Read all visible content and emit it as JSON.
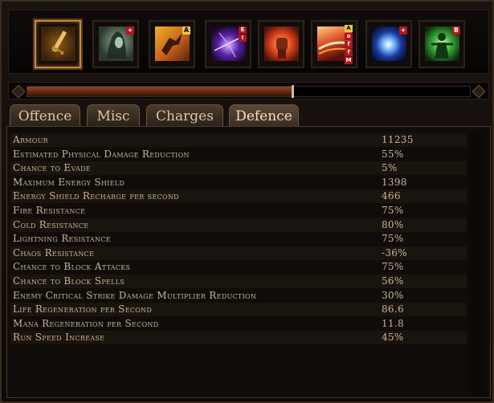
{
  "skills": [
    {
      "name": "sword-skill-icon",
      "active": true,
      "tags": []
    },
    {
      "name": "hooded-figure-skill-icon",
      "tags": [
        {
          "text": "+",
          "color": "red"
        }
      ]
    },
    {
      "name": "leaping-warrior-skill-icon",
      "tags": [
        {
          "text": "A",
          "color": "green"
        }
      ]
    },
    {
      "name": "purple-energy-skill-icon",
      "tags": [
        {
          "text": "E",
          "color": "red"
        },
        {
          "text": "!",
          "color": "red"
        }
      ]
    },
    {
      "name": "fire-fist-skill-icon",
      "tags": []
    },
    {
      "name": "flame-slash-skill-icon",
      "tags": [
        {
          "text": "A",
          "color": "green"
        },
        {
          "text": "o",
          "color": "red"
        },
        {
          "text": "f",
          "color": "red"
        },
        {
          "text": "f",
          "color": "red"
        },
        {
          "text": "M",
          "color": "red"
        }
      ]
    },
    {
      "name": "blue-orb-skill-icon",
      "tags": [
        {
          "text": "+",
          "color": "red"
        }
      ]
    },
    {
      "name": "green-aura-skill-icon",
      "tags": [
        {
          "text": "B",
          "color": "red"
        }
      ]
    }
  ],
  "experience": {
    "progress": 0.6
  },
  "tabs": {
    "offence": "Offence",
    "misc": "Misc",
    "charges": "Charges",
    "defence": "Defence",
    "active": "defence"
  },
  "stats": [
    {
      "label": "Armour",
      "value": "11235"
    },
    {
      "label": "Estimated Physical Damage Reduction",
      "value": "55%"
    },
    {
      "label": "Chance to Evade",
      "value": "5%"
    },
    {
      "label": "Maximum Energy Shield",
      "value": "1398"
    },
    {
      "label": "Energy Shield Recharge per second",
      "value": "466"
    },
    {
      "label": "Fire Resistance",
      "value": "75%"
    },
    {
      "label": "Cold Resistance",
      "value": "80%"
    },
    {
      "label": "Lightning Resistance",
      "value": "75%"
    },
    {
      "label": "Chaos Resistance",
      "value": "-36%"
    },
    {
      "label": "Chance to Block Attacks",
      "value": "75%"
    },
    {
      "label": "Chance to Block Spells",
      "value": "56%"
    },
    {
      "label": "Enemy Critical Strike Damage Multiplier Reduction",
      "value": "30%"
    },
    {
      "label": "Life Regeneration per Second",
      "value": "86.6"
    },
    {
      "label": "Mana Regeneration per Second",
      "value": "11.8"
    },
    {
      "label": "Run Speed Increase",
      "value": "45%"
    }
  ]
}
